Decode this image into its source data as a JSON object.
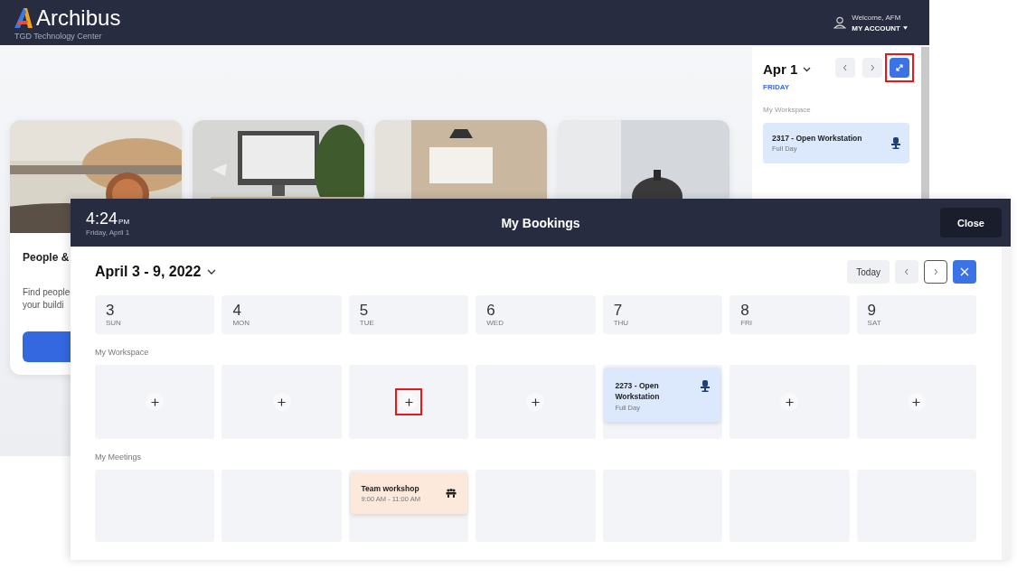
{
  "app": {
    "logo": "Archibus",
    "site": "TGD Technology Center",
    "welcome": "Welcome, AFM",
    "account": "MY ACCOUNT"
  },
  "cards": [
    {
      "kind": "picture",
      "title": "People &",
      "lines": [
        "Find people",
        "your buildi"
      ]
    },
    {
      "kind": "picture"
    },
    {
      "kind": "picture"
    },
    {
      "kind": "picture"
    }
  ],
  "side_panel": {
    "date": "Apr 1",
    "weekday": "FRIDAY",
    "section": "My Workspace",
    "expand_highlighted": true,
    "booking": {
      "title": "2317 - Open Workstation",
      "subtitle": "Full Day"
    }
  },
  "modal": {
    "time": "4:24",
    "meridiem": "PM",
    "date": "Friday, April 1",
    "title": "My Bookings",
    "close": "Close",
    "range": "April 3 - 9, 2022",
    "today": "Today",
    "nav": [
      {
        "kind": "prev",
        "focused": false
      },
      {
        "kind": "next",
        "focused": true
      }
    ],
    "days": [
      {
        "number": "3",
        "weekday": "SUN"
      },
      {
        "number": "4",
        "weekday": "MON"
      },
      {
        "number": "5",
        "weekday": "TUE"
      },
      {
        "number": "6",
        "weekday": "WED"
      },
      {
        "number": "7",
        "weekday": "THU"
      },
      {
        "number": "8",
        "weekday": "FRI"
      },
      {
        "number": "9",
        "weekday": "SAT"
      }
    ],
    "sections": [
      {
        "label": "My Workspace",
        "cells": [
          {
            "kind": "add",
            "highlighted": false
          },
          {
            "kind": "add",
            "highlighted": false
          },
          {
            "kind": "add",
            "highlighted": true
          },
          {
            "kind": "add",
            "highlighted": false
          },
          {
            "kind": "workspace",
            "title": "2273 - Open Workstation",
            "subtitle": "Full Day"
          },
          {
            "kind": "add",
            "highlighted": false
          },
          {
            "kind": "add",
            "highlighted": false
          }
        ]
      },
      {
        "label": "My Meetings",
        "cells": [
          {
            "kind": "empty"
          },
          {
            "kind": "empty"
          },
          {
            "kind": "meeting",
            "title": "Team workshop",
            "subtitle": "9:00 AM - 11:00 AM"
          },
          {
            "kind": "empty"
          },
          {
            "kind": "empty"
          },
          {
            "kind": "empty"
          },
          {
            "kind": "empty"
          }
        ]
      }
    ]
  }
}
